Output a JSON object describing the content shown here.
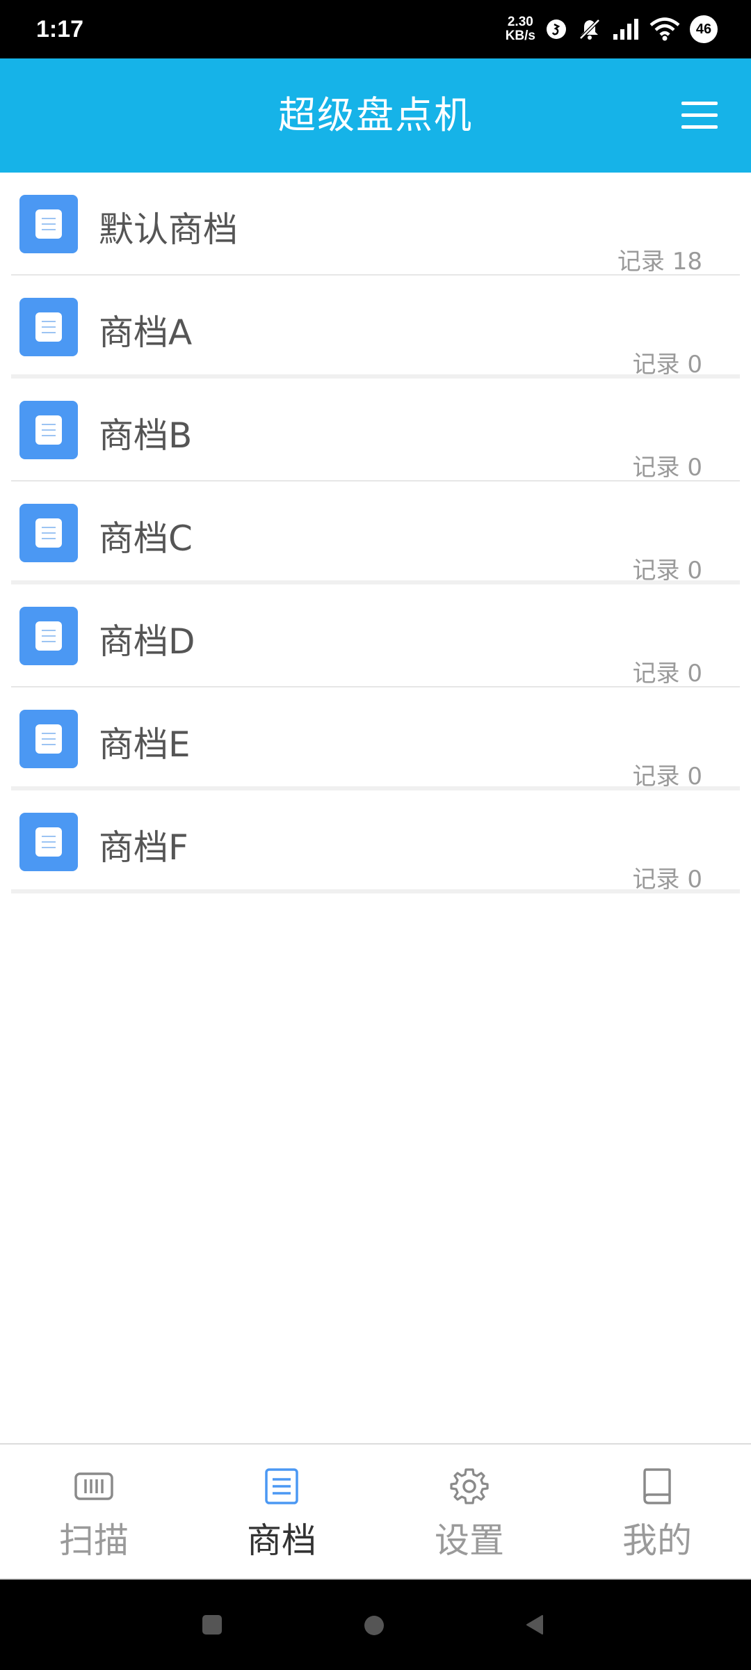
{
  "status_bar": {
    "time": "1:17",
    "net_speed_value": "2.30",
    "net_speed_unit": "KB/s",
    "battery": "46"
  },
  "app_bar": {
    "title": "超级盘点机",
    "menu_icon": "hamburger-menu-icon"
  },
  "archives": [
    {
      "name": "默认商档",
      "count": "记录 18"
    },
    {
      "name": "商档A",
      "count": "记录 0"
    },
    {
      "name": "商档B",
      "count": "记录 0"
    },
    {
      "name": "商档C",
      "count": "记录 0"
    },
    {
      "name": "商档D",
      "count": "记录 0"
    },
    {
      "name": "商档E",
      "count": "记录 0"
    },
    {
      "name": "商档F",
      "count": "记录 0"
    }
  ],
  "bottom_nav": {
    "items": [
      {
        "label": "扫描",
        "icon": "barcode-scan-icon"
      },
      {
        "label": "商档",
        "icon": "document-list-icon",
        "active": true
      },
      {
        "label": "设置",
        "icon": "gear-icon"
      },
      {
        "label": "我的",
        "icon": "book-icon"
      }
    ]
  },
  "colors": {
    "app_bar": "#16b3e8",
    "icon_tile": "#4b98f3",
    "active_nav": "#4b98f3"
  }
}
